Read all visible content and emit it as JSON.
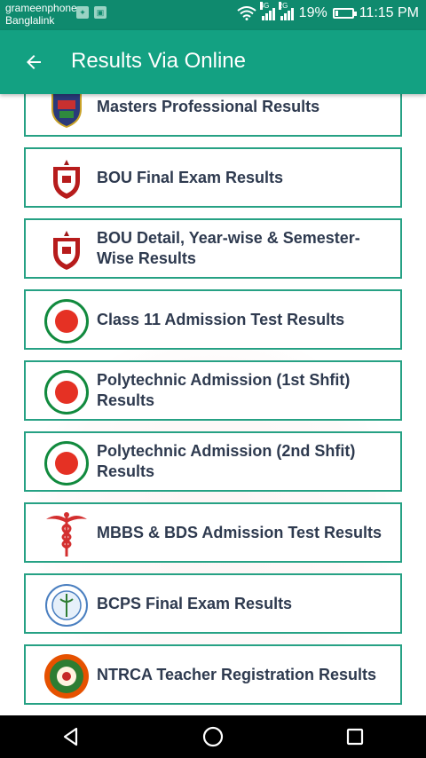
{
  "status": {
    "carrier1": "grameenphone",
    "carrier2": "Banglalink",
    "net1": "3G",
    "net2": "2G",
    "battery": "19%",
    "battery_level": 0.19,
    "time": "11:15 PM"
  },
  "appbar": {
    "title": "Results Via Online"
  },
  "items": [
    {
      "label": "Masters Professional Results",
      "logo": "university-crest"
    },
    {
      "label": "BOU Final Exam Results",
      "logo": "bou-shield"
    },
    {
      "label": "BOU Detail, Year-wise & Semester-Wise Results",
      "logo": "bou-shield"
    },
    {
      "label": "Class 11 Admission Test Results",
      "logo": "govt-seal"
    },
    {
      "label": "Polytechnic Admission (1st Shfit) Results",
      "logo": "govt-seal"
    },
    {
      "label": "Polytechnic Admission (2nd Shfit) Results",
      "logo": "govt-seal"
    },
    {
      "label": "MBBS & BDS Admission Test Results",
      "logo": "caduceus"
    },
    {
      "label": "BCPS Final Exam Results",
      "logo": "bcps-seal"
    },
    {
      "label": "NTRCA Teacher Registration Results",
      "logo": "ntrca-seal"
    }
  ],
  "colors": {
    "primary": "#13a182",
    "statusbar": "#0f8a6e",
    "card_border": "#26a184",
    "label_text": "#2e3a4f"
  }
}
